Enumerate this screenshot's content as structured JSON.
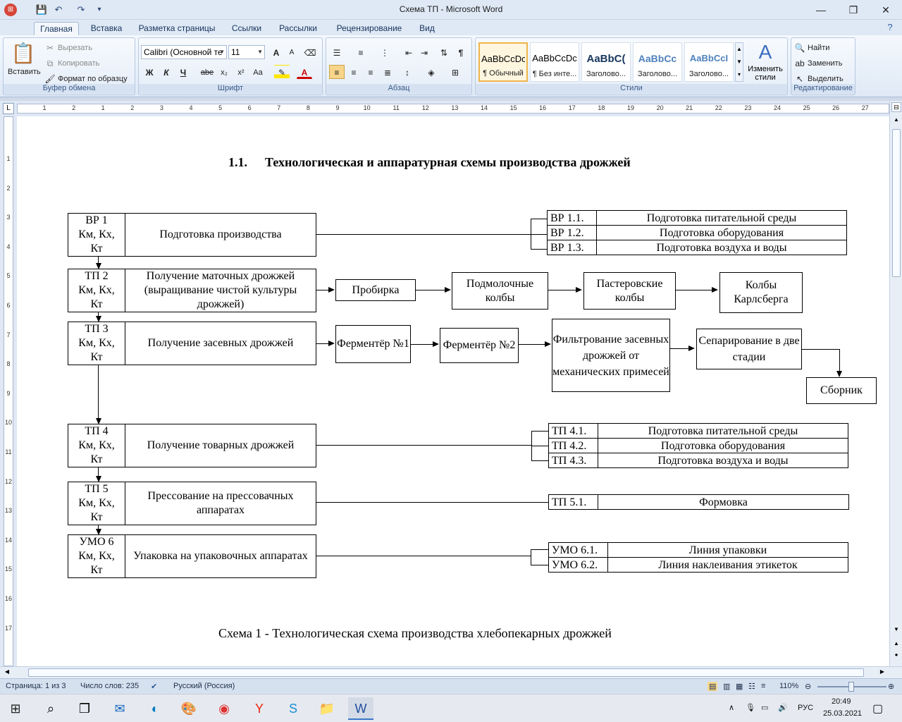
{
  "window": {
    "title": "Схема ТП - Microsoft Word",
    "minimize": "—",
    "restore": "❐",
    "close": "✕"
  },
  "quick_access": {
    "save": "💾",
    "undo": "↶",
    "redo": "↷",
    "more": "▾"
  },
  "tabs": [
    {
      "label": "Главная",
      "active": true
    },
    {
      "label": "Вставка"
    },
    {
      "label": "Разметка страницы"
    },
    {
      "label": "Ссылки"
    },
    {
      "label": "Рассылки"
    },
    {
      "label": "Рецензирование"
    },
    {
      "label": "Вид"
    }
  ],
  "ribbon": {
    "clipboard": {
      "paste": "Вставить",
      "cut": "Вырезать",
      "copy": "Копировать",
      "format_painter": "Формат по образцу",
      "label": "Буфер обмена"
    },
    "font": {
      "name": "Calibri (Основной те",
      "size": "11",
      "bold": "Ж",
      "italic": "К",
      "underline": "Ч",
      "strike": "abe",
      "subscript": "x₂",
      "superscript": "x²",
      "change_case": "Aa",
      "grow": "A",
      "shrink": "A",
      "label": "Шрифт"
    },
    "paragraph": {
      "label": "Абзац",
      "pilcrow": "¶"
    },
    "styles": {
      "items": [
        {
          "sample": "AaBbCcDc",
          "name": "¶ Обычный",
          "selected": true
        },
        {
          "sample": "AaBbCcDc",
          "name": "¶ Без инте..."
        },
        {
          "sample": "AaBbC(",
          "name": "Заголово..."
        },
        {
          "sample": "AaBbCc",
          "name": "Заголово..."
        },
        {
          "sample": "AaBbCcI",
          "name": "Заголово..."
        }
      ],
      "change": "Изменить стили",
      "label": "Стили"
    },
    "editing": {
      "find": "Найти",
      "replace": "Заменить",
      "select": "Выделить",
      "label": "Редактирование"
    }
  },
  "ruler": {
    "numbers": [
      "1",
      "2",
      "1",
      "2",
      "3",
      "4",
      "5",
      "6",
      "7",
      "8",
      "9",
      "10",
      "11",
      "12",
      "13",
      "14",
      "15",
      "16",
      "17",
      "18",
      "19",
      "20",
      "21",
      "22",
      "23",
      "24",
      "25",
      "26",
      "27"
    ],
    "vnumbers": [
      "1",
      "2",
      "3",
      "4",
      "5",
      "6",
      "7",
      "8",
      "9",
      "10",
      "11",
      "12",
      "13",
      "14",
      "15",
      "16",
      "17"
    ],
    "tab_button": "L"
  },
  "document": {
    "heading_number": "1.1.",
    "heading": "Технологическая и аппаратурная схемы производства дрожжей",
    "stages": [
      {
        "code": "ВР 1\nКм, Кх,\nКт",
        "name": "Подготовка производства"
      },
      {
        "code": "ТП 2\nКм, Кх,\nКт",
        "name": "Получение маточных дрожжей (выращивание чистой культуры дрожжей)"
      },
      {
        "code": "ТП 3\nКм, Кх,\nКт",
        "name": "Получение засевных дрожжей"
      },
      {
        "code": "ТП 4\nКм, Кх,\nКт",
        "name": "Получение товарных дрожжей"
      },
      {
        "code": "ТП 5\nКм, Кх,\nКт",
        "name": "Прессование на прессовачных аппаратах"
      },
      {
        "code": "УМО 6\nКм, Кх,\nКт",
        "name": "Упаковка на упаковочных аппаратах"
      }
    ],
    "vr1_sub": [
      {
        "code": "ВР 1.1.",
        "name": "Подготовка питательной среды"
      },
      {
        "code": "ВР 1.2.",
        "name": "Подготовка оборудования"
      },
      {
        "code": "ВР 1.3.",
        "name": "Подготовка воздуха и воды"
      }
    ],
    "tp2_chain": [
      "Пробирка",
      "Подмолочные колбы",
      "Пастеровские колбы",
      "Колбы Карлсберга"
    ],
    "tp3_chain": [
      "Ферментёр №1",
      "Ферментёр №2",
      "Фильтрование засевных дрожжей от механических примесей",
      "Сепарирование в две стадии",
      "Сборник"
    ],
    "tp4_sub": [
      {
        "code": "ТП 4.1.",
        "name": "Подготовка питательной среды"
      },
      {
        "code": "ТП 4.2.",
        "name": "Подготовка оборудования"
      },
      {
        "code": "ТП 4.3.",
        "name": "Подготовка воздуха и воды"
      }
    ],
    "tp5_sub": [
      {
        "code": "ТП 5.1.",
        "name": "Формовка"
      }
    ],
    "umo6_sub": [
      {
        "code": "УМО 6.1.",
        "name": "Линия упаковки"
      },
      {
        "code": "УМО 6.2.",
        "name": "Линия наклеивания этикеток"
      }
    ],
    "caption": "Схема 1 -  Технологическая схема производства хлебопекарных дрожжей"
  },
  "status": {
    "page": "Страница: 1 из 3",
    "words": "Число слов: 235",
    "language": "Русский (Россия)",
    "zoom": "110%"
  },
  "taskbar": {
    "lang": "РУС",
    "time": "20:49",
    "date": "25.03.2021"
  }
}
